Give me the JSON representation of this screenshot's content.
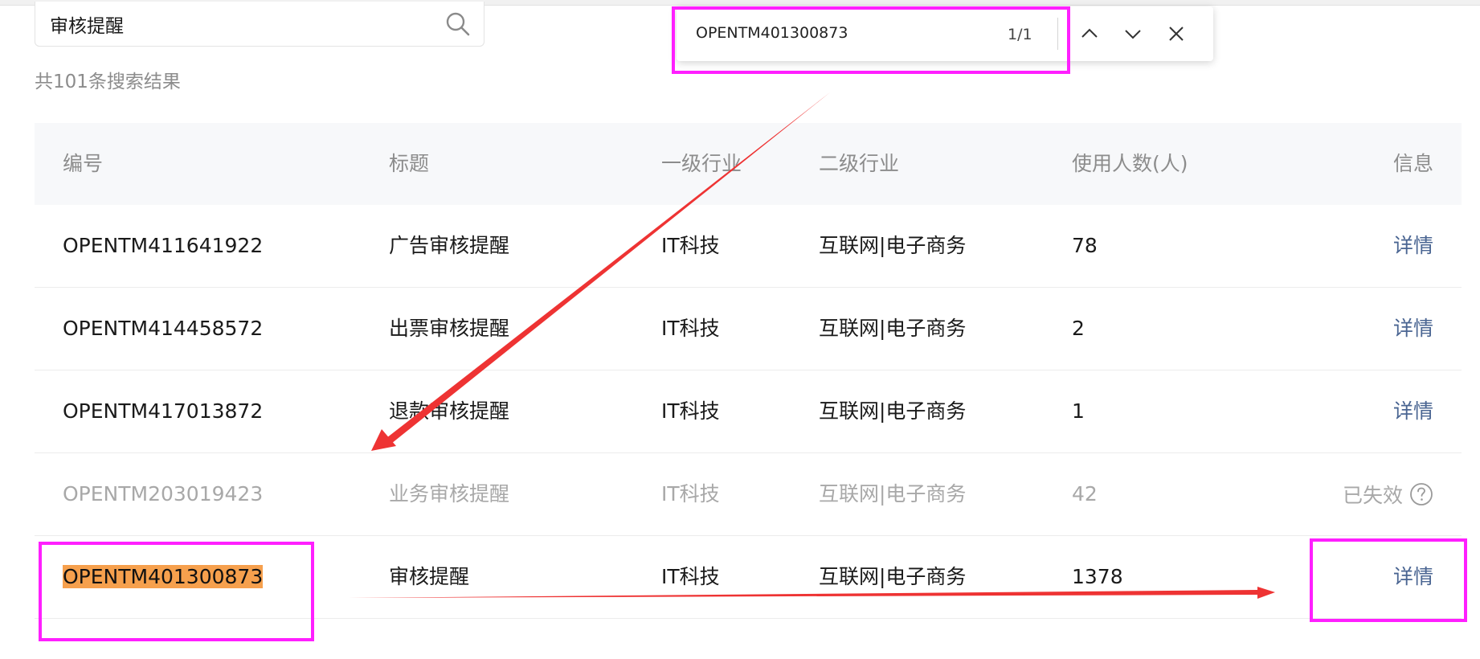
{
  "search": {
    "value": "审核提醒",
    "icon": "search-icon"
  },
  "result_count": "共101条搜索结果",
  "find_bar": {
    "query": "OPENTM401300873",
    "count": "1/1",
    "icons": [
      "chevron-up-icon",
      "chevron-down-icon",
      "close-icon"
    ]
  },
  "table": {
    "headers": [
      "编号",
      "标题",
      "一级行业",
      "二级行业",
      "使用人数(人)",
      "信息"
    ],
    "rows": [
      {
        "id": "OPENTM411641922",
        "title": "广告审核提醒",
        "industry1": "IT科技",
        "industry2": "互联网|电子商务",
        "users": "78",
        "info": "详情"
      },
      {
        "id": "OPENTM414458572",
        "title": "出票审核提醒",
        "industry1": "IT科技",
        "industry2": "互联网|电子商务",
        "users": "2",
        "info": "详情"
      },
      {
        "id": "OPENTM417013872",
        "title": "退款审核提醒",
        "industry1": "IT科技",
        "industry2": "互联网|电子商务",
        "users": "1",
        "info": "详情"
      },
      {
        "id": "OPENTM203019423",
        "title": "业务审核提醒",
        "industry1": "IT科技",
        "industry2": "互联网|电子商务",
        "users": "42",
        "info": "已失效",
        "expired": true
      },
      {
        "id": "OPENTM401300873",
        "title": "审核提醒",
        "industry1": "IT科技",
        "industry2": "互联网|电子商务",
        "users": "1378",
        "info": "详情",
        "highlighted": true
      }
    ]
  },
  "colors": {
    "link": "#4a6592",
    "highlight": "#f6a04d",
    "annotation": "#ff1fff",
    "arrow": "#ee3333"
  }
}
